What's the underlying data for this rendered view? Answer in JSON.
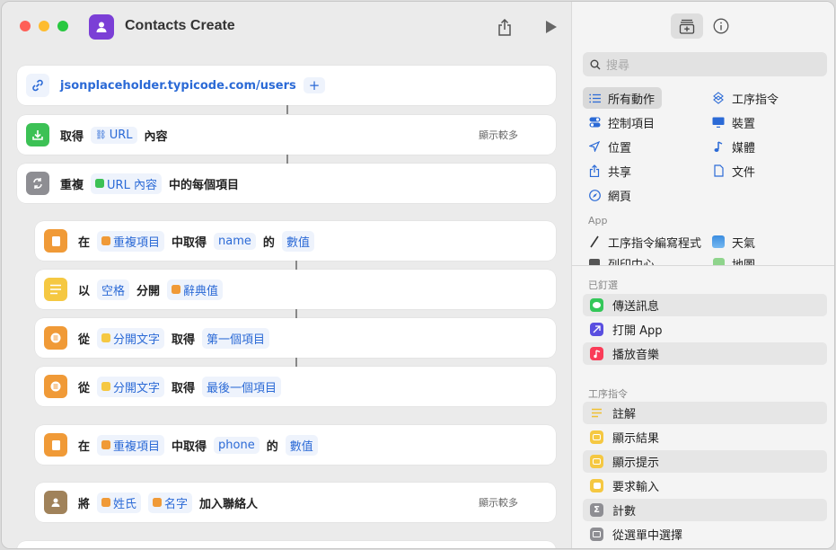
{
  "window": {
    "title": "Contacts Create"
  },
  "colors": {
    "accent": "#2b6ad6",
    "app_icon": "#7b3fd6",
    "close": "#fe5f57",
    "minimize": "#febc2e",
    "zoom": "#28c840"
  },
  "actions": {
    "url": {
      "value": "jsonplaceholder.typicode.com/users",
      "add": "+"
    },
    "get": {
      "verb": "取得",
      "token": "URL",
      "suffix": "內容",
      "more": "顯示較多"
    },
    "repeat": {
      "verb": "重複",
      "token": "URL 內容",
      "suffix": "中的每個項目"
    },
    "dict1": {
      "w1": "在",
      "t1": "重複項目",
      "w2": "中取得",
      "t2": "name",
      "w3": "的",
      "t3": "數值"
    },
    "split": {
      "w1": "以",
      "t1": "空格",
      "w2": "分開",
      "t2": "辭典值"
    },
    "first": {
      "w1": "從",
      "t1": "分開文字",
      "w2": "取得",
      "t2": "第一個項目"
    },
    "last": {
      "w1": "從",
      "t1": "分開文字",
      "w2": "取得",
      "t2": "最後一個項目"
    },
    "dict2": {
      "w1": "在",
      "t1": "重複項目",
      "w2": "中取得",
      "t2": "phone",
      "w3": "的",
      "t3": "數值"
    },
    "contact": {
      "w1": "將",
      "t1": "姓氏",
      "t2": "名字",
      "w2": "加入聯絡人",
      "more": "顯示較多"
    }
  },
  "sidebar": {
    "search_placeholder": "搜尋",
    "categories": {
      "all": "所有動作",
      "shortcuts": "工序指令",
      "control": "控制項目",
      "device": "裝置",
      "location": "位置",
      "media": "媒體",
      "share": "共享",
      "documents": "文件",
      "web": "網頁"
    },
    "app_header": "App",
    "apps": {
      "editor": "工序指令編寫程式",
      "weather": "天氣",
      "print": "列印中心",
      "maps": "地圖"
    },
    "pinned_header": "已釘選",
    "pinned": {
      "send": "傳送訊息",
      "open_app": "打開 App",
      "play_music": "播放音樂"
    },
    "scripting_header": "工序指令",
    "scripting": {
      "comment": "註解",
      "show_result": "顯示結果",
      "show_alert": "顯示提示",
      "ask_input": "要求輸入",
      "count": "計數",
      "choose_menu": "從選單中選擇"
    }
  }
}
